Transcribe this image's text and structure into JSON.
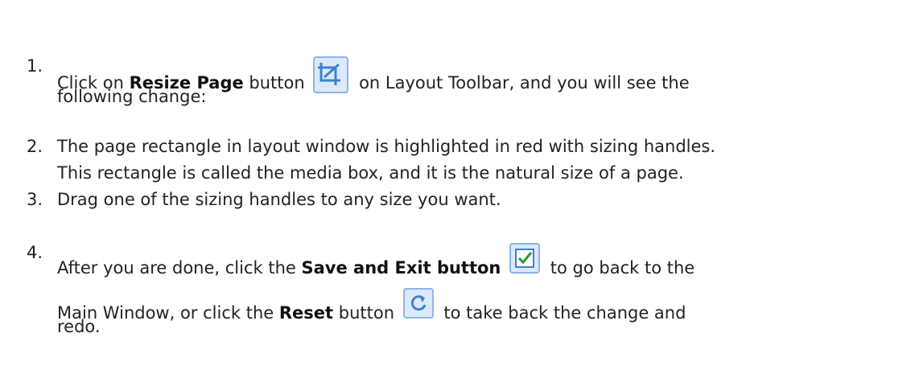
{
  "steps": [
    {
      "number": "1.",
      "pre": "Click on ",
      "bold": "Resize Page",
      "post": " button",
      "post2": " on Layout Toolbar, and you will see the",
      "line2": "following change:"
    },
    {
      "number": "2.",
      "line1": "The page rectangle in layout window is highlighted in red with sizing handles.",
      "line2": "This rectangle is called the media box, and it is the natural size of a page."
    },
    {
      "number": "3.",
      "line1": "Drag one of the sizing handles to any size you want."
    },
    {
      "number": "4.",
      "pre": "After you are done, click the ",
      "bold": "Save and Exit button",
      "post": " to go back to the",
      "line2_pre": "Main Window, or click the ",
      "line2_bold": "Reset",
      "line2_mid": " button",
      "line2_post": " to take back the change and",
      "line3": "redo."
    }
  ],
  "icons": {
    "resize": "resize-page-icon",
    "save_exit": "save-and-exit-icon",
    "reset": "reset-icon"
  },
  "colors": {
    "icon_blue": "#3f7fd0",
    "icon_frame": "#8fb4e6",
    "icon_bg": "#dbe9fb"
  }
}
